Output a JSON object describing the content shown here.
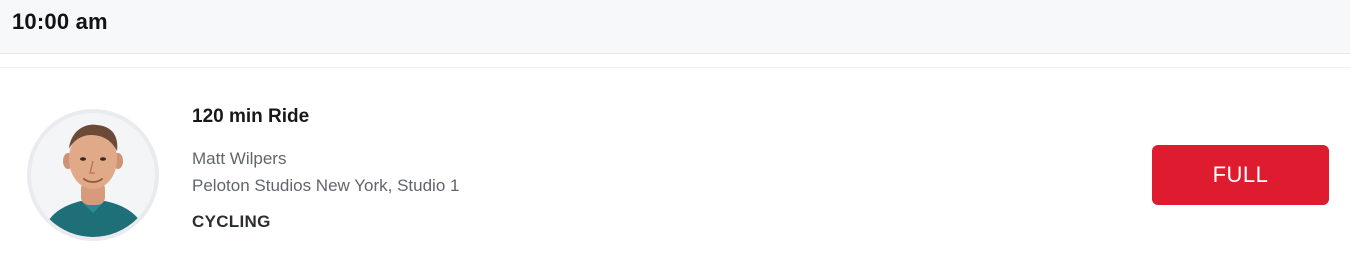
{
  "schedule": {
    "time": "10:00 am"
  },
  "class": {
    "title": "120 min Ride",
    "instructor": "Matt Wilpers",
    "location": "Peloton Studios New York, Studio 1",
    "discipline": "CYCLING",
    "status_button": "FULL"
  },
  "colors": {
    "accent": "#df1c2f",
    "header_bg": "#f7f8f9"
  }
}
